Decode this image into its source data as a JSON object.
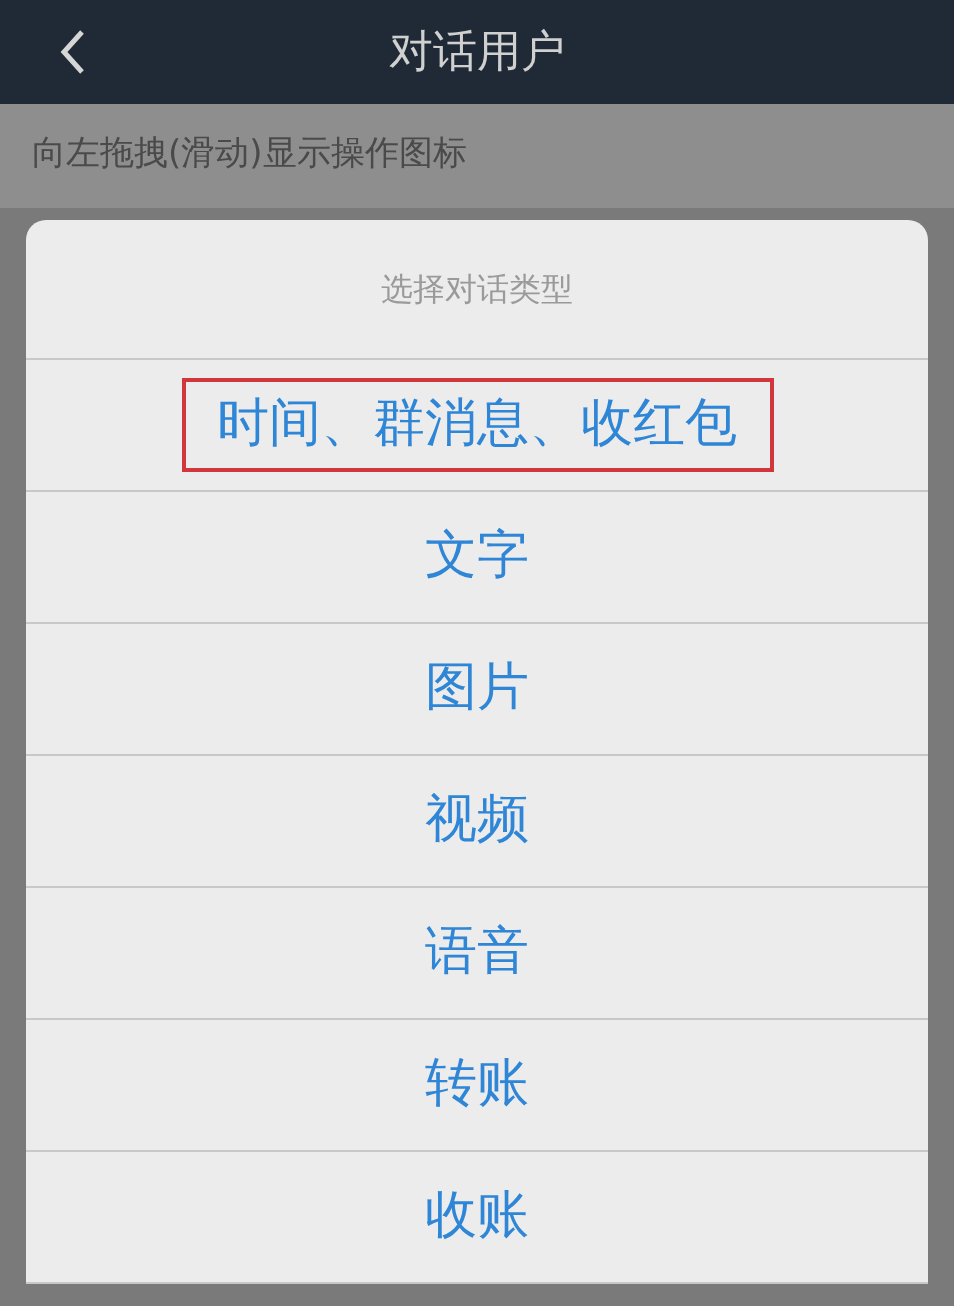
{
  "header": {
    "title": "对话用户"
  },
  "hint": "向左拖拽(滑动)显示操作图标",
  "dialog": {
    "title": "选择对话类型",
    "options": [
      {
        "label": "时间、群消息、收红包",
        "highlighted": true
      },
      {
        "label": "文字",
        "highlighted": false
      },
      {
        "label": "图片",
        "highlighted": false
      },
      {
        "label": "视频",
        "highlighted": false
      },
      {
        "label": "语音",
        "highlighted": false
      },
      {
        "label": "转账",
        "highlighted": false
      },
      {
        "label": "收账",
        "highlighted": false
      }
    ]
  }
}
